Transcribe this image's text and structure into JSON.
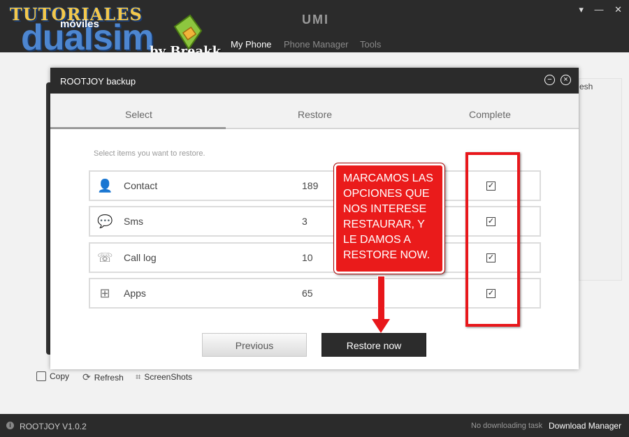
{
  "watermark": {
    "line1": "TUTORIALES",
    "line2": "móviles",
    "line3": "dualsim",
    "line4": "by Breakk"
  },
  "app": {
    "brand": "UMI",
    "nav": [
      "My Phone",
      "Phone Manager",
      "Tools"
    ],
    "window_controls": [
      "minimize-icon",
      "close-icon"
    ]
  },
  "background": {
    "side_button_label": "esh",
    "tools": [
      "Copy",
      "Refresh",
      "ScreenShots"
    ]
  },
  "modal": {
    "title": "ROOTJOY backup",
    "steps": [
      "Select",
      "Restore",
      "Complete"
    ],
    "hint": "Select items you want to restore.",
    "items": [
      {
        "icon": "contact-icon",
        "label": "Contact",
        "count": "189",
        "checked": true
      },
      {
        "icon": "sms-icon",
        "label": "Sms",
        "count": "3",
        "checked": true
      },
      {
        "icon": "phone-icon",
        "label": "Call log",
        "count": "10",
        "checked": true
      },
      {
        "icon": "apps-icon",
        "label": "Apps",
        "count": "65",
        "checked": true
      }
    ],
    "previous_label": "Previous",
    "restore_label": "Restore now"
  },
  "annotation": {
    "lines": [
      "MARCAMOS LAS",
      "OPCIONES QUE",
      "NOS INTERESE",
      "RESTAURAR, Y",
      "LE DAMOS A",
      "RESTORE NOW."
    ],
    "color": "#e8171b"
  },
  "statusbar": {
    "version": "ROOTJOY V1.0.2",
    "task": "No downloading task",
    "download_manager": "Download Manager"
  }
}
